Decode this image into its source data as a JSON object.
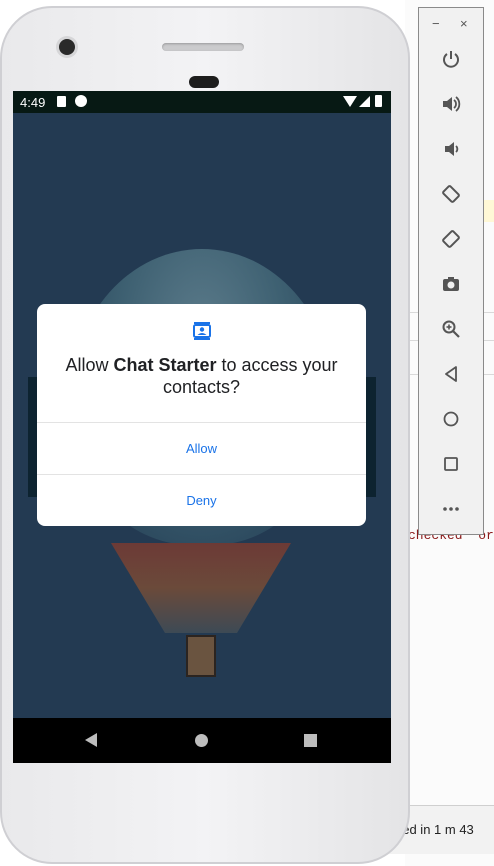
{
  "status_bar": {
    "time": "4:49"
  },
  "dialog": {
    "title_prefix": "Allow ",
    "app_name": "Chat Starter",
    "title_suffix": " to access your contacts?",
    "allow_label": "Allow",
    "deny_label": "Deny",
    "icon": "contacts-icon"
  },
  "emulator_panel": {
    "minimize": "−",
    "close": "×",
    "buttons": [
      "power-icon",
      "volume-up-icon",
      "volume-down-icon",
      "rotate-left-icon",
      "rotate-right-icon",
      "camera-icon",
      "zoom-icon",
      "back-icon",
      "home-icon",
      "overview-icon",
      "more-icon"
    ]
  },
  "background": {
    "code_snippet": "checked\" or",
    "status_text": "ned in 1 m 43"
  },
  "colors": {
    "accent": "#1a73e8",
    "status_bar": "#071914",
    "scrim": "#233a52"
  }
}
